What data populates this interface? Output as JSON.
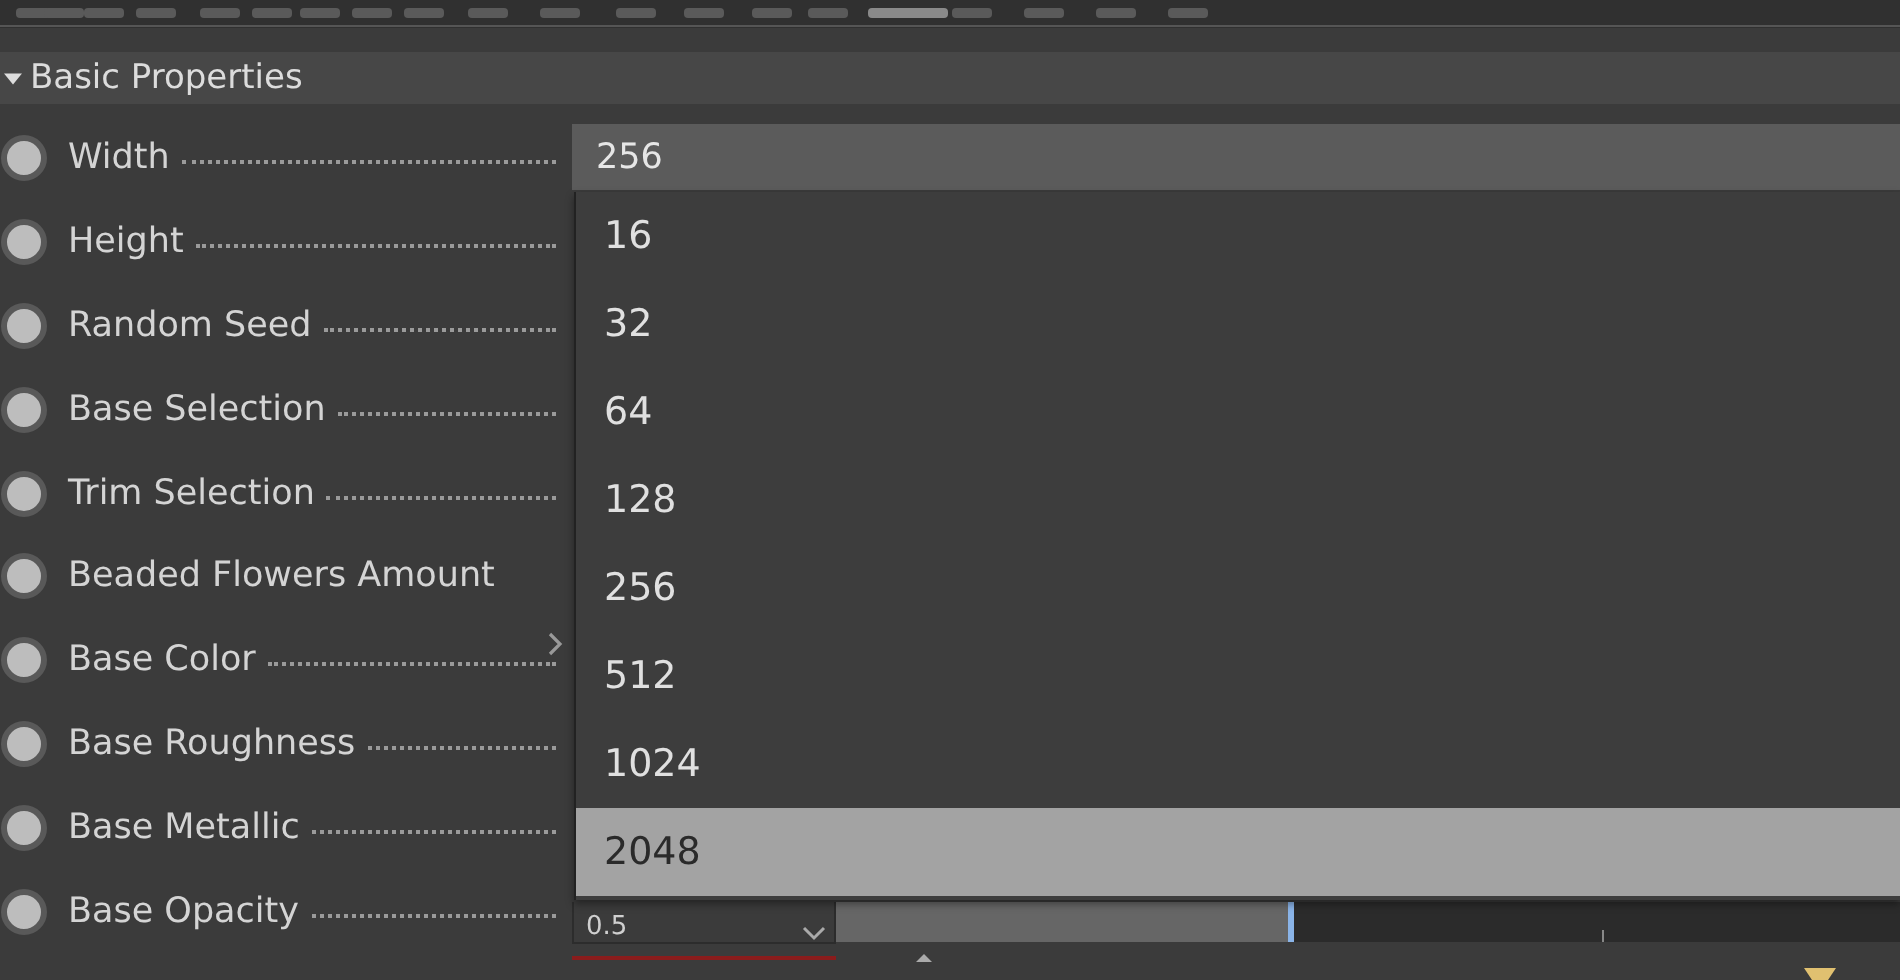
{
  "section": {
    "title": "Basic Properties",
    "expanded": true
  },
  "properties": [
    {
      "label": "Width",
      "leader": true,
      "kind": "dropdown",
      "value": "256"
    },
    {
      "label": "Height",
      "leader": true,
      "kind": "plain"
    },
    {
      "label": "Random Seed",
      "leader": true,
      "kind": "plain"
    },
    {
      "label": "Base Selection",
      "leader": true,
      "kind": "plain"
    },
    {
      "label": "Trim Selection",
      "leader": true,
      "kind": "plain"
    },
    {
      "label": "Beaded Flowers Amount",
      "leader": false,
      "kind": "plain"
    },
    {
      "label": "Base Color",
      "leader": true,
      "kind": "submenu"
    },
    {
      "label": "Base Roughness",
      "leader": true,
      "kind": "plain"
    },
    {
      "label": "Base Metallic",
      "leader": true,
      "kind": "plain"
    },
    {
      "label": "Base Opacity",
      "leader": true,
      "kind": "slider",
      "value": "0.5",
      "level": 0.43
    }
  ],
  "dropdown_options": [
    {
      "label": "16",
      "selected": false
    },
    {
      "label": "32",
      "selected": false
    },
    {
      "label": "64",
      "selected": false
    },
    {
      "label": "128",
      "selected": false
    },
    {
      "label": "256",
      "selected": false
    },
    {
      "label": "512",
      "selected": false
    },
    {
      "label": "1024",
      "selected": false
    },
    {
      "label": "2048",
      "selected": true
    }
  ]
}
